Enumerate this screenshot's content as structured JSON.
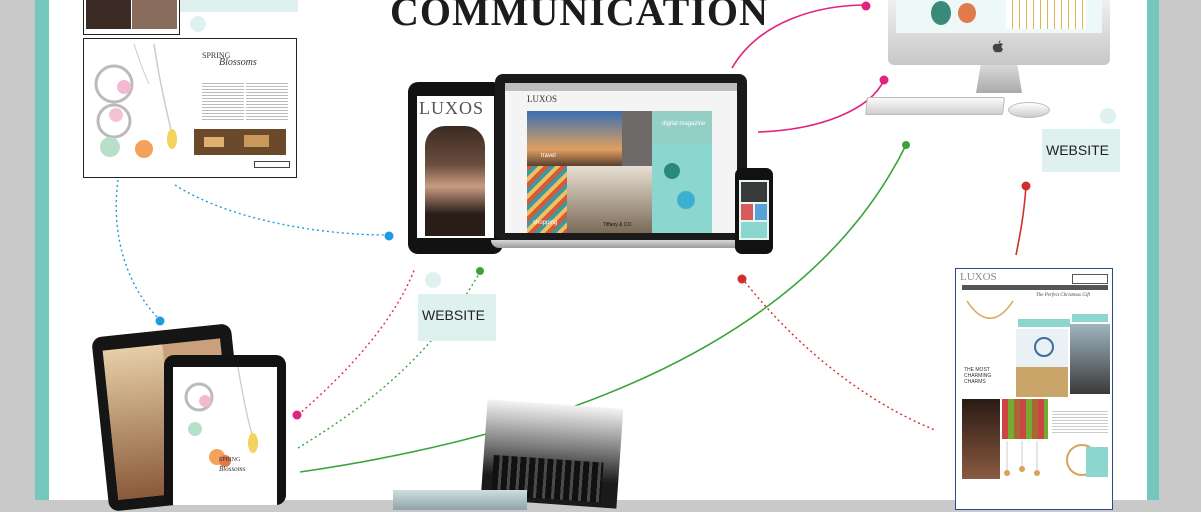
{
  "title": "COMMUNICATION",
  "tags": {
    "center": "WEBSITE",
    "right": "WEBSITE"
  },
  "print_spread": {
    "heading_line1": "SPRING",
    "heading_line2": "Blossoms"
  },
  "tablet_mag": {
    "heading_line1": "SPRING",
    "heading_line2": "Blossoms"
  },
  "laptop_site": {
    "logo": "LUXOS",
    "tile_travel": "travel",
    "tile_shopping": "shopping",
    "tile_digital": "digital magazine",
    "tile_brand": "Tiffany & CO."
  },
  "ipad_site": {
    "logo": "LUXOS"
  },
  "web_page": {
    "logo": "LUXOS",
    "headline": "The Perfect Christmas Gift",
    "section": "THE MOST CHARMING CHARMS"
  },
  "colors": {
    "teal": "#74c7bd",
    "magenta": "#e0247e",
    "blue": "#1e9be0",
    "green": "#3aa43a",
    "red": "#d0302a"
  }
}
